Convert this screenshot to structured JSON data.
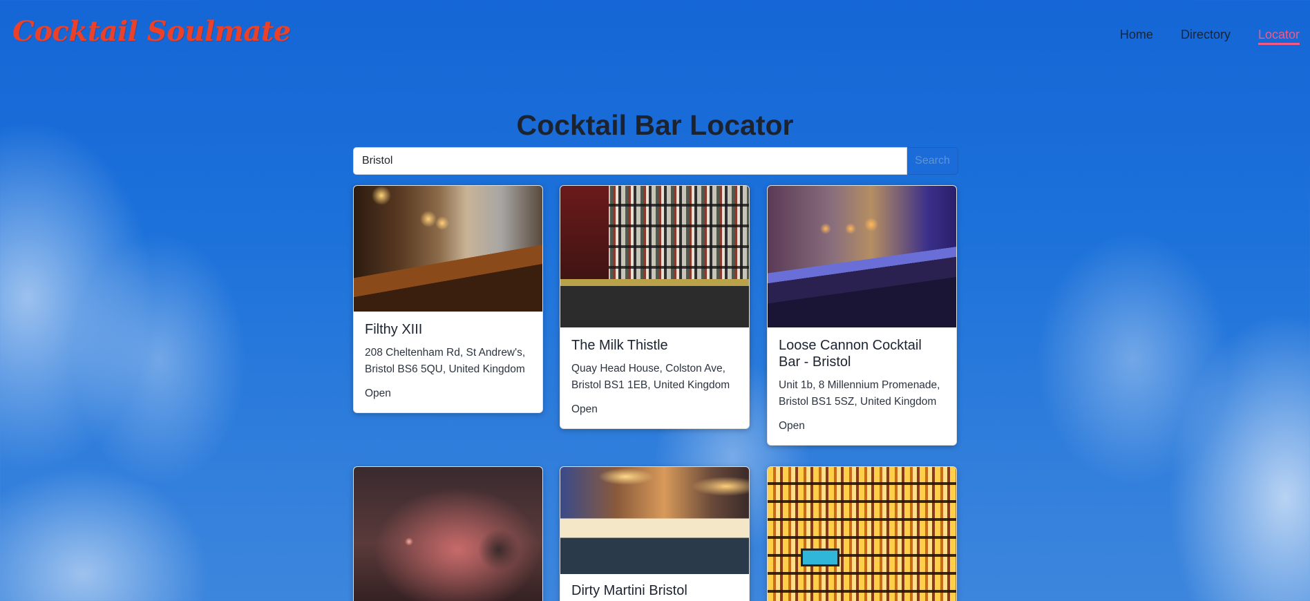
{
  "header": {
    "logo": "Cocktail Soulmate",
    "nav": [
      {
        "label": "Home",
        "active": false
      },
      {
        "label": "Directory",
        "active": false
      },
      {
        "label": "Locator",
        "active": true
      }
    ],
    "active_color": "#f35a86",
    "logo_color": "#ec4129"
  },
  "main": {
    "title": "Cocktail Bar Locator",
    "search": {
      "value": "Bristol",
      "button_label": "Search"
    },
    "cards": [
      {
        "name": "Filthy XIII",
        "address": "208 Cheltenham Rd, St Andrew's, Bristol BS6 5QU, United Kingdom",
        "status": "Open"
      },
      {
        "name": "The Milk Thistle",
        "address": "Quay Head House, Colston Ave, Bristol BS1 1EB, United Kingdom",
        "status": "Open"
      },
      {
        "name": "Loose Cannon Cocktail Bar - Bristol",
        "address": "Unit 1b, 8 Millennium Promenade, Bristol BS1 5SZ, United Kingdom",
        "status": "Open"
      },
      {
        "name": "",
        "address": "",
        "status": ""
      },
      {
        "name": "Dirty Martini Bristol",
        "address": "",
        "status": ""
      },
      {
        "name": "",
        "address": "",
        "status": ""
      }
    ]
  }
}
